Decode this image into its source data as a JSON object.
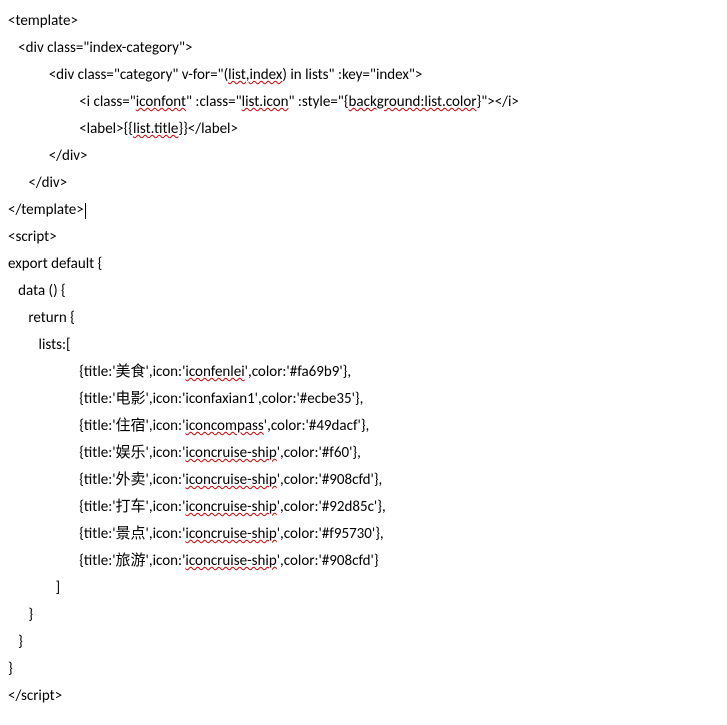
{
  "line1_a": "<template>",
  "line2_a": "   <div class=\"index-category\">",
  "line3_a": "            <div class=\"category\" v-for=\"(",
  "line3_b": "list,index",
  "line3_c": ") in lists\" :key=\"index\">",
  "line4_a": "                     <i class=\"",
  "line4_b": "iconfont",
  "line4_c": "\" :class=\"",
  "line4_d": "list.icon",
  "line4_e": "\" :style=\"{",
  "line4_f": "background:list.color",
  "line4_g": "}\"></i>",
  "line5_a": "                     <label>{{",
  "line5_b": "list.title",
  "line5_c": "}}</label>",
  "line6_a": "            </div>",
  "line7_a": "      </div>",
  "line8_a": "</template>",
  "line9_a": "<script>",
  "line10_a": "export default {",
  "line11_a": "   data () {",
  "line12_a": "      return {",
  "line13_a": "         lists:[",
  "item_indent": "                     ",
  "item1_a": "{title:'美食',icon:'",
  "item1_b": "iconfenlei",
  "item1_c": "',color:'#fa69b9'},",
  "item2_a": "{title:'电影',icon:'iconfaxian1',color:'#ecbe35'},",
  "item3_a": "{title:'住宿',icon:'",
  "item3_b": "iconcompass",
  "item3_c": "',color:'#49dacf'},",
  "item4_a": "{title:'娱乐',icon:'",
  "item4_b": "iconcruise-ship",
  "item4_c": "',color:'#f60'},",
  "item5_a": "{title:'外卖',icon:'",
  "item5_b": "iconcruise-ship",
  "item5_c": "',color:'#908cfd'},",
  "item6_a": "{title:'打车',icon:'",
  "item6_b": "iconcruise-ship",
  "item6_c": "',color:'#92d85c'},",
  "item7_a": "{title:'景点',icon:'",
  "item7_b": "iconcruise-ship",
  "item7_c": "',color:'#f95730'},",
  "item8_a": "{title:'旅游',icon:'",
  "item8_b": "iconcruise-ship",
  "item8_c": "',color:'#908cfd'}",
  "line22_a": "              ]",
  "line23_a": "      }",
  "line24_a": "   }",
  "line25_a": "}",
  "line26_a": "</",
  "line26_b": "script",
  "line26_c": ">"
}
